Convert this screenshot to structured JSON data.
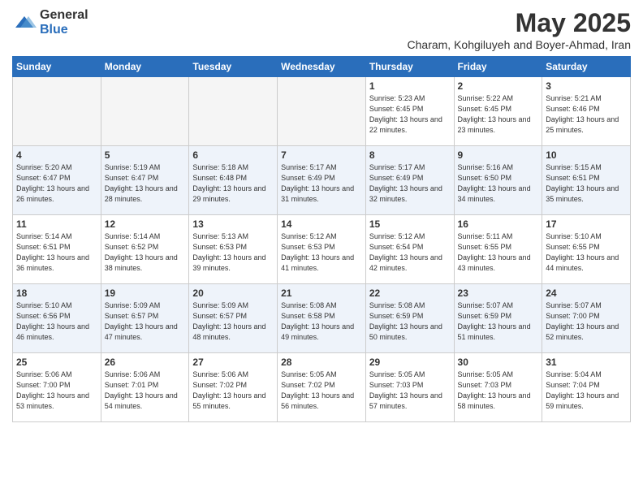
{
  "logo": {
    "general": "General",
    "blue": "Blue"
  },
  "header": {
    "month": "May 2025",
    "subtitle": "Charam, Kohgiluyeh and Boyer-Ahmad, Iran"
  },
  "weekdays": [
    "Sunday",
    "Monday",
    "Tuesday",
    "Wednesday",
    "Thursday",
    "Friday",
    "Saturday"
  ],
  "weeks": [
    [
      {
        "day": "",
        "sunrise": "",
        "sunset": "",
        "daylight": ""
      },
      {
        "day": "",
        "sunrise": "",
        "sunset": "",
        "daylight": ""
      },
      {
        "day": "",
        "sunrise": "",
        "sunset": "",
        "daylight": ""
      },
      {
        "day": "",
        "sunrise": "",
        "sunset": "",
        "daylight": ""
      },
      {
        "day": "1",
        "sunrise": "Sunrise: 5:23 AM",
        "sunset": "Sunset: 6:45 PM",
        "daylight": "Daylight: 13 hours and 22 minutes."
      },
      {
        "day": "2",
        "sunrise": "Sunrise: 5:22 AM",
        "sunset": "Sunset: 6:45 PM",
        "daylight": "Daylight: 13 hours and 23 minutes."
      },
      {
        "day": "3",
        "sunrise": "Sunrise: 5:21 AM",
        "sunset": "Sunset: 6:46 PM",
        "daylight": "Daylight: 13 hours and 25 minutes."
      }
    ],
    [
      {
        "day": "4",
        "sunrise": "Sunrise: 5:20 AM",
        "sunset": "Sunset: 6:47 PM",
        "daylight": "Daylight: 13 hours and 26 minutes."
      },
      {
        "day": "5",
        "sunrise": "Sunrise: 5:19 AM",
        "sunset": "Sunset: 6:47 PM",
        "daylight": "Daylight: 13 hours and 28 minutes."
      },
      {
        "day": "6",
        "sunrise": "Sunrise: 5:18 AM",
        "sunset": "Sunset: 6:48 PM",
        "daylight": "Daylight: 13 hours and 29 minutes."
      },
      {
        "day": "7",
        "sunrise": "Sunrise: 5:17 AM",
        "sunset": "Sunset: 6:49 PM",
        "daylight": "Daylight: 13 hours and 31 minutes."
      },
      {
        "day": "8",
        "sunrise": "Sunrise: 5:17 AM",
        "sunset": "Sunset: 6:49 PM",
        "daylight": "Daylight: 13 hours and 32 minutes."
      },
      {
        "day": "9",
        "sunrise": "Sunrise: 5:16 AM",
        "sunset": "Sunset: 6:50 PM",
        "daylight": "Daylight: 13 hours and 34 minutes."
      },
      {
        "day": "10",
        "sunrise": "Sunrise: 5:15 AM",
        "sunset": "Sunset: 6:51 PM",
        "daylight": "Daylight: 13 hours and 35 minutes."
      }
    ],
    [
      {
        "day": "11",
        "sunrise": "Sunrise: 5:14 AM",
        "sunset": "Sunset: 6:51 PM",
        "daylight": "Daylight: 13 hours and 36 minutes."
      },
      {
        "day": "12",
        "sunrise": "Sunrise: 5:14 AM",
        "sunset": "Sunset: 6:52 PM",
        "daylight": "Daylight: 13 hours and 38 minutes."
      },
      {
        "day": "13",
        "sunrise": "Sunrise: 5:13 AM",
        "sunset": "Sunset: 6:53 PM",
        "daylight": "Daylight: 13 hours and 39 minutes."
      },
      {
        "day": "14",
        "sunrise": "Sunrise: 5:12 AM",
        "sunset": "Sunset: 6:53 PM",
        "daylight": "Daylight: 13 hours and 41 minutes."
      },
      {
        "day": "15",
        "sunrise": "Sunrise: 5:12 AM",
        "sunset": "Sunset: 6:54 PM",
        "daylight": "Daylight: 13 hours and 42 minutes."
      },
      {
        "day": "16",
        "sunrise": "Sunrise: 5:11 AM",
        "sunset": "Sunset: 6:55 PM",
        "daylight": "Daylight: 13 hours and 43 minutes."
      },
      {
        "day": "17",
        "sunrise": "Sunrise: 5:10 AM",
        "sunset": "Sunset: 6:55 PM",
        "daylight": "Daylight: 13 hours and 44 minutes."
      }
    ],
    [
      {
        "day": "18",
        "sunrise": "Sunrise: 5:10 AM",
        "sunset": "Sunset: 6:56 PM",
        "daylight": "Daylight: 13 hours and 46 minutes."
      },
      {
        "day": "19",
        "sunrise": "Sunrise: 5:09 AM",
        "sunset": "Sunset: 6:57 PM",
        "daylight": "Daylight: 13 hours and 47 minutes."
      },
      {
        "day": "20",
        "sunrise": "Sunrise: 5:09 AM",
        "sunset": "Sunset: 6:57 PM",
        "daylight": "Daylight: 13 hours and 48 minutes."
      },
      {
        "day": "21",
        "sunrise": "Sunrise: 5:08 AM",
        "sunset": "Sunset: 6:58 PM",
        "daylight": "Daylight: 13 hours and 49 minutes."
      },
      {
        "day": "22",
        "sunrise": "Sunrise: 5:08 AM",
        "sunset": "Sunset: 6:59 PM",
        "daylight": "Daylight: 13 hours and 50 minutes."
      },
      {
        "day": "23",
        "sunrise": "Sunrise: 5:07 AM",
        "sunset": "Sunset: 6:59 PM",
        "daylight": "Daylight: 13 hours and 51 minutes."
      },
      {
        "day": "24",
        "sunrise": "Sunrise: 5:07 AM",
        "sunset": "Sunset: 7:00 PM",
        "daylight": "Daylight: 13 hours and 52 minutes."
      }
    ],
    [
      {
        "day": "25",
        "sunrise": "Sunrise: 5:06 AM",
        "sunset": "Sunset: 7:00 PM",
        "daylight": "Daylight: 13 hours and 53 minutes."
      },
      {
        "day": "26",
        "sunrise": "Sunrise: 5:06 AM",
        "sunset": "Sunset: 7:01 PM",
        "daylight": "Daylight: 13 hours and 54 minutes."
      },
      {
        "day": "27",
        "sunrise": "Sunrise: 5:06 AM",
        "sunset": "Sunset: 7:02 PM",
        "daylight": "Daylight: 13 hours and 55 minutes."
      },
      {
        "day": "28",
        "sunrise": "Sunrise: 5:05 AM",
        "sunset": "Sunset: 7:02 PM",
        "daylight": "Daylight: 13 hours and 56 minutes."
      },
      {
        "day": "29",
        "sunrise": "Sunrise: 5:05 AM",
        "sunset": "Sunset: 7:03 PM",
        "daylight": "Daylight: 13 hours and 57 minutes."
      },
      {
        "day": "30",
        "sunrise": "Sunrise: 5:05 AM",
        "sunset": "Sunset: 7:03 PM",
        "daylight": "Daylight: 13 hours and 58 minutes."
      },
      {
        "day": "31",
        "sunrise": "Sunrise: 5:04 AM",
        "sunset": "Sunset: 7:04 PM",
        "daylight": "Daylight: 13 hours and 59 minutes."
      }
    ]
  ]
}
